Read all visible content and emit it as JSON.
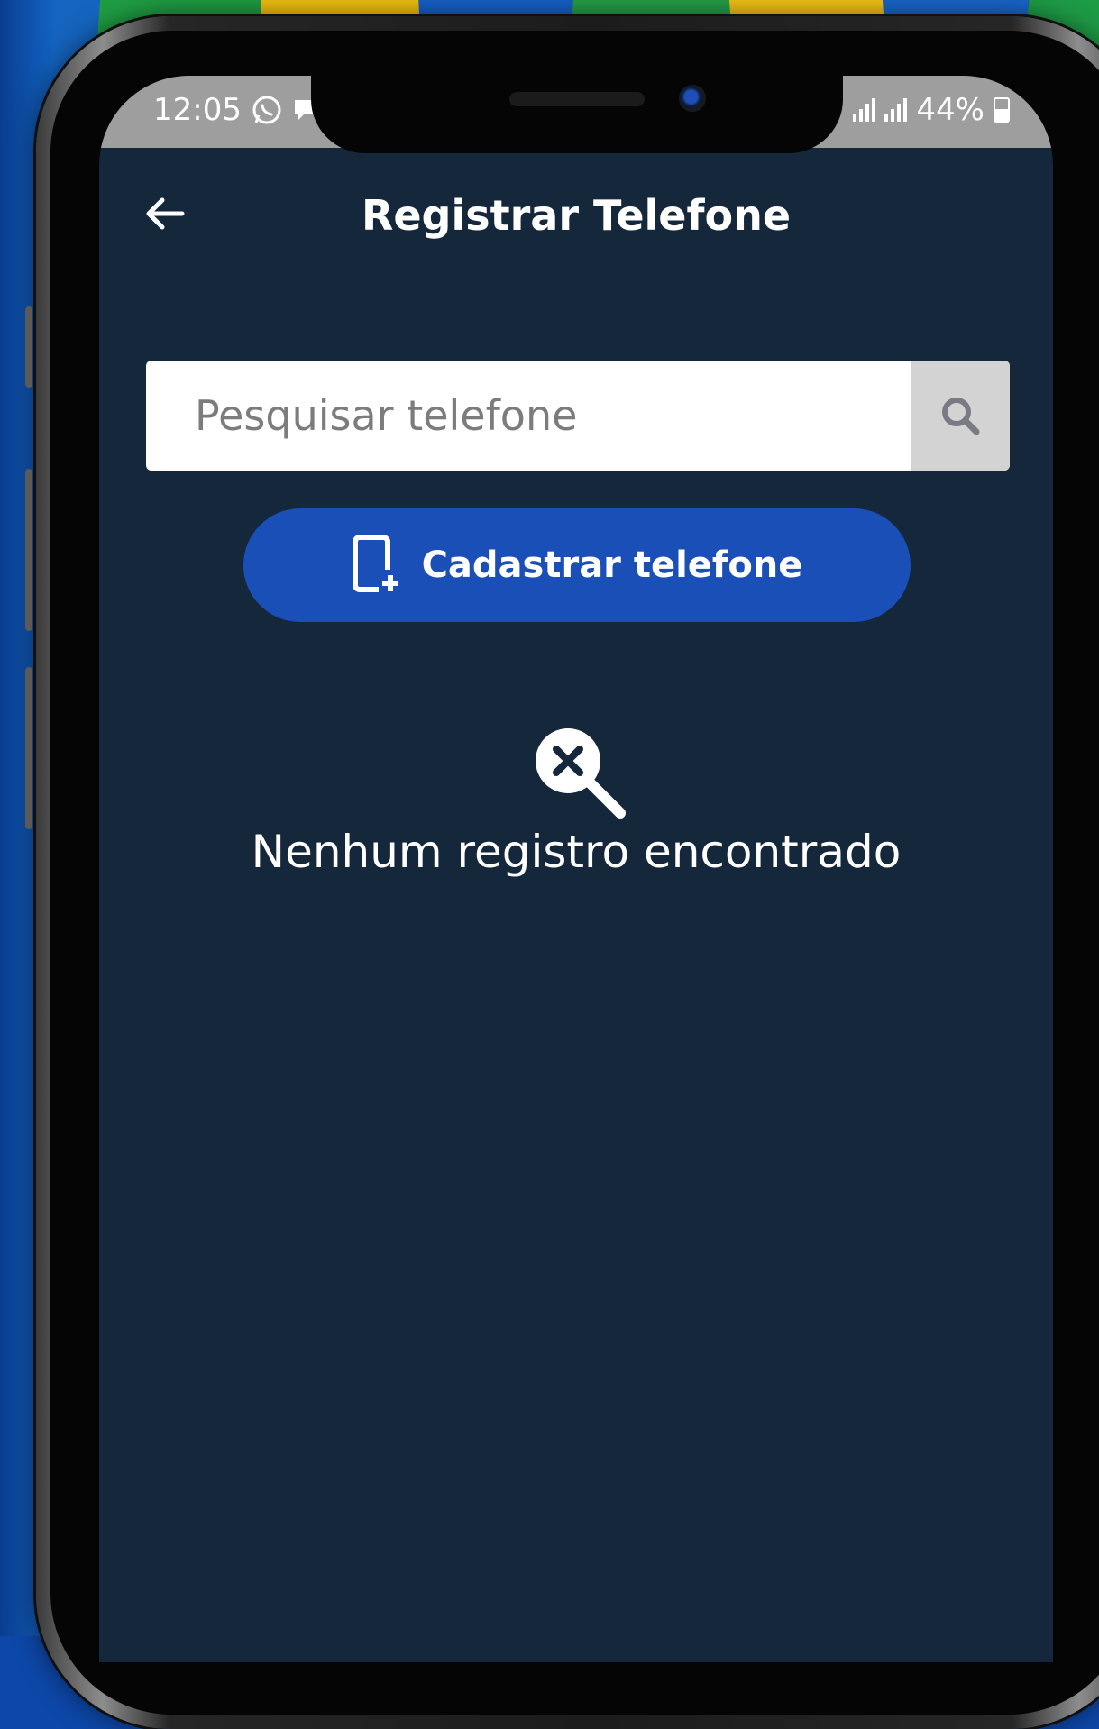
{
  "status_bar": {
    "time": "12:05",
    "battery": "44%",
    "icons": [
      "whatsapp-icon",
      "chat-icon",
      "signal-icon",
      "signal-icon",
      "battery-icon"
    ]
  },
  "header": {
    "title": "Registrar Telefone",
    "back_icon": "arrow-left-icon"
  },
  "search": {
    "placeholder": "Pesquisar telefone",
    "value": "",
    "icon": "search-icon"
  },
  "register_button": {
    "label": "Cadastrar telefone",
    "icon": "phone-add-icon"
  },
  "empty_state": {
    "icon": "search-off-icon",
    "message": "Nenhum registro encontrado"
  },
  "colors": {
    "screen_background": "#15273a",
    "primary_button": "#1a4fb8",
    "status_bar": "#9e9e9e",
    "text": "#ffffff"
  }
}
